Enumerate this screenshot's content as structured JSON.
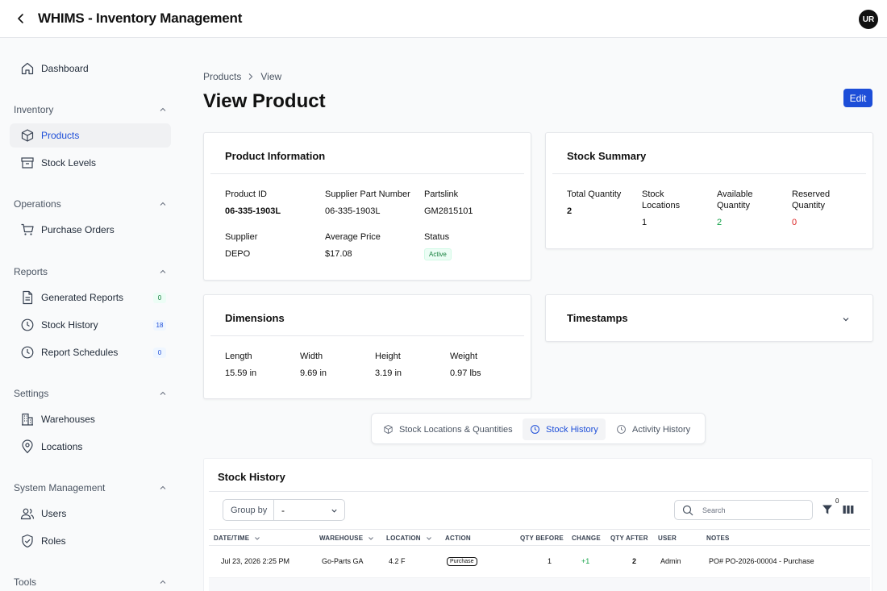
{
  "app": {
    "title": "WHIMS - Inventory Management",
    "avatar_initials": "UR"
  },
  "sidebar": {
    "dashboard": "Dashboard",
    "sections": {
      "inventory": "Inventory",
      "operations": "Operations",
      "reports": "Reports",
      "settings": "Settings",
      "system": "System Management",
      "tools": "Tools"
    },
    "items": {
      "products": "Products",
      "stock_levels": "Stock Levels",
      "purchase_orders": "Purchase Orders",
      "generated_reports": "Generated Reports",
      "stock_history": "Stock History",
      "report_schedules": "Report Schedules",
      "warehouses": "Warehouses",
      "locations": "Locations",
      "users": "Users",
      "roles": "Roles"
    },
    "badges": {
      "generated_reports": "0",
      "stock_history": "18",
      "report_schedules": "0"
    }
  },
  "breadcrumb": {
    "root": "Products",
    "current": "View"
  },
  "page": {
    "title": "View Product",
    "edit_label": "Edit"
  },
  "product_info": {
    "title": "Product Information",
    "product_id_label": "Product ID",
    "product_id": "06-335-1903L",
    "supplier_part_label": "Supplier Part Number",
    "supplier_part": "06-335-1903L",
    "partslink_label": "Partslink",
    "partslink": "GM2815101",
    "supplier_label": "Supplier",
    "supplier": "DEPO",
    "avg_price_label": "Average Price",
    "avg_price": "$17.08",
    "status_label": "Status",
    "status": "Active"
  },
  "stock_summary": {
    "title": "Stock Summary",
    "total_label": "Total Quantity",
    "total": "2",
    "locations_label": "Stock Locations",
    "locations": "1",
    "available_label": "Available Quantity",
    "available": "2",
    "reserved_label": "Reserved Quantity",
    "reserved": "0"
  },
  "dimensions": {
    "title": "Dimensions",
    "length_label": "Length",
    "length": "15.59 in",
    "width_label": "Width",
    "width": "9.69 in",
    "height_label": "Height",
    "height": "3.19 in",
    "weight_label": "Weight",
    "weight": "0.97 lbs"
  },
  "timestamps": {
    "title": "Timestamps"
  },
  "tabs": {
    "locations": "Stock Locations & Quantities",
    "history": "Stock History",
    "activity": "Activity History"
  },
  "history": {
    "title": "Stock History",
    "group_by_label": "Group by",
    "group_by_value": "-",
    "search_placeholder": "Search",
    "filter_count": "0",
    "columns": {
      "datetime": "DATE/TIME",
      "warehouse": "WAREHOUSE",
      "location": "LOCATION",
      "action": "ACTION",
      "qty_before": "QTY BEFORE",
      "change": "CHANGE",
      "qty_after": "QTY AFTER",
      "user": "USER",
      "notes": "NOTES"
    },
    "rows": [
      {
        "datetime": "Jul 23, 2026 2:25 PM",
        "warehouse": "Go-Parts GA",
        "location": "4.2 F",
        "action": "Purchase",
        "qty_before": "1",
        "change": "+1",
        "qty_after": "2",
        "user": "Admin",
        "notes": "PO# PO-2026-00004 - Purchase"
      }
    ]
  },
  "colors": {
    "accent": "#1d4ed8",
    "positive": "#16a34a",
    "negative": "#dc2626"
  }
}
